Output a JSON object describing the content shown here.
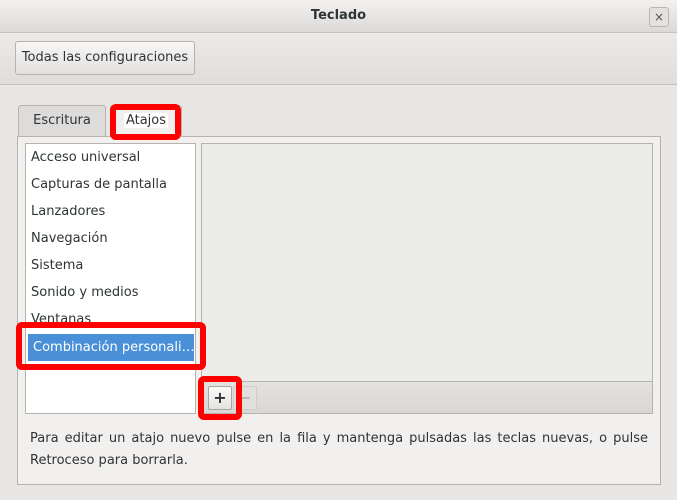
{
  "window": {
    "title": "Teclado",
    "close_icon": "×"
  },
  "toolbar": {
    "all_settings_label": "Todas las configuraciones"
  },
  "tabs": [
    {
      "label": "Escritura",
      "active": false
    },
    {
      "label": "Atajos",
      "active": true
    }
  ],
  "categories": [
    {
      "label": "Acceso universal"
    },
    {
      "label": "Capturas de pantalla"
    },
    {
      "label": "Lanzadores"
    },
    {
      "label": "Navegación"
    },
    {
      "label": "Sistema"
    },
    {
      "label": "Sonido y medios"
    },
    {
      "label": "Ventanas"
    },
    {
      "label": "Combinación personali…",
      "selected": true
    }
  ],
  "buttons": {
    "add_label": "+",
    "remove_label": "−"
  },
  "hint": "Para editar un atajo nuevo pulse en la fila y mantenga pulsadas las teclas nuevas, o pulse Retroceso para borrarla.",
  "colors": {
    "selection": "#4a90d9",
    "highlight": "#ff0000"
  }
}
